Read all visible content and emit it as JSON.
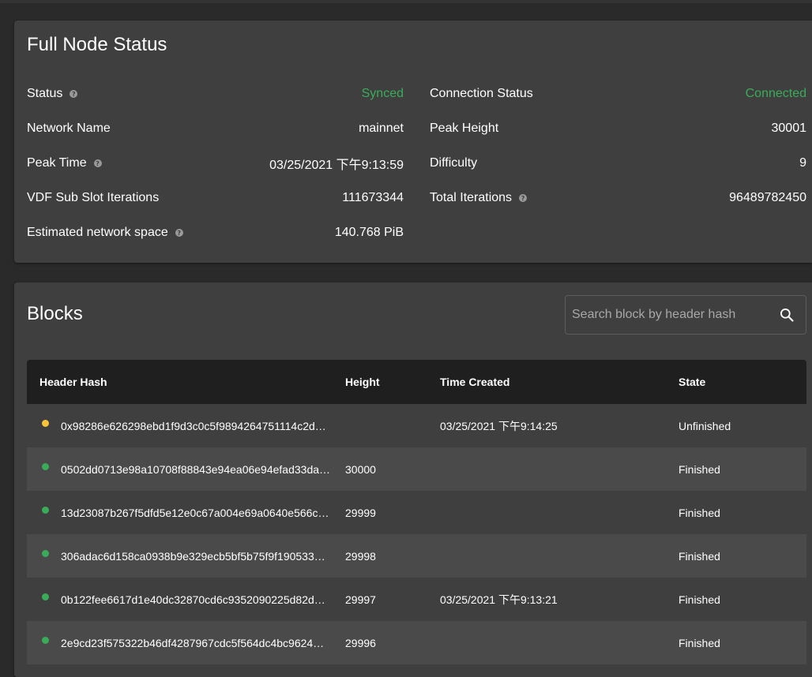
{
  "status": {
    "title": "Full Node Status",
    "left": [
      {
        "label": "Status",
        "help": true,
        "value": "Synced",
        "color": "green"
      },
      {
        "label": "Network Name",
        "help": false,
        "value": "mainnet"
      },
      {
        "label": "Peak Time",
        "help": true,
        "value": "03/25/2021 下午9:13:59"
      },
      {
        "label": "VDF Sub Slot Iterations",
        "help": false,
        "value": "111673344"
      },
      {
        "label": "Estimated network space",
        "help": true,
        "value": "140.768 PiB"
      }
    ],
    "right": [
      {
        "label": "Connection Status",
        "help": false,
        "value": "Connected",
        "color": "green"
      },
      {
        "label": "Peak Height",
        "help": false,
        "value": "30001"
      },
      {
        "label": "Difficulty",
        "help": false,
        "value": "9"
      },
      {
        "label": "Total Iterations",
        "help": true,
        "value": "96489782450"
      }
    ],
    "help_glyph": "?"
  },
  "blocks": {
    "title": "Blocks",
    "search_placeholder": "Search block by header hash",
    "search_icon": "search-icon",
    "columns": {
      "hash": "Header Hash",
      "height": "Height",
      "time": "Time Created",
      "state": "State"
    },
    "rows": [
      {
        "hash": "0x98286e626298ebd1f9d3c0c5f9894264751114c2d…",
        "height": "",
        "time": "03/25/2021 下午9:14:25",
        "state": "Unfinished",
        "dot": "#f7c43a"
      },
      {
        "hash": "0502dd0713e98a10708f88843e94ea06e94efad33da…",
        "height": "30000",
        "time": "",
        "state": "Finished",
        "dot": "#3aac59"
      },
      {
        "hash": "13d23087b267f5dfd5e12e0c67a004e69a0640e566c…",
        "height": "29999",
        "time": "",
        "state": "Finished",
        "dot": "#3aac59"
      },
      {
        "hash": "306adac6d158ca0938b9e329ecb5bf5b75f9f190533…",
        "height": "29998",
        "time": "",
        "state": "Finished",
        "dot": "#3aac59"
      },
      {
        "hash": "0b122fee6617d1e40dc32870cd6c9352090225d82d…",
        "height": "29997",
        "time": "03/25/2021 下午9:13:21",
        "state": "Finished",
        "dot": "#3aac59"
      },
      {
        "hash": "2e9cd23f575322b46df4287967cdc5f564dc4bc9624…",
        "height": "29996",
        "time": "",
        "state": "Finished",
        "dot": "#3aac59"
      }
    ]
  },
  "colors": {
    "green": "#3aac59",
    "yellow": "#f7c43a",
    "card": "#3f3f3f",
    "table_header": "#1f1f1f"
  }
}
